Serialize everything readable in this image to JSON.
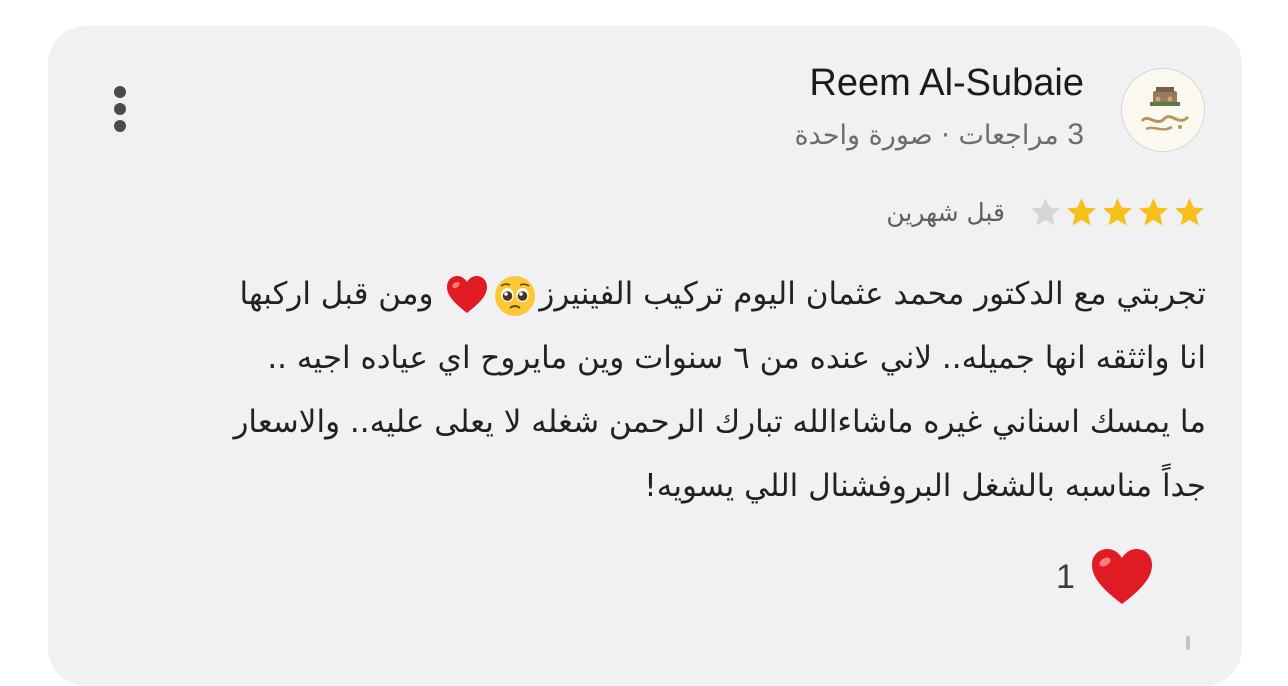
{
  "review": {
    "author_name": "Reem Al-Subaie",
    "reviews_count": "3",
    "reviews_label": "مراجعات",
    "separator": "·",
    "photos_label": "صورة واحدة",
    "rating": 4,
    "rating_max": 5,
    "date": "قبل شهرين",
    "text_line1_part1": "تجربتي مع الدكتور محمد عثمان اليوم تركيب الفينيرز",
    "text_line1_part2": " ومن قبل اركبها",
    "text_rest": "انا واثثقه انها جميله.. لاني عنده من ٦ سنوات وين مايروح اي عياده اجيه ..\nما يمسك اسناني غيره ماشاءالله تبارك الرحمن شغله لا يعلى عليه.. والاسعار\nجداً مناسبه بالشغل البروفشنال اللي يسويه!",
    "reaction_count": "1"
  },
  "icons": {
    "more": "more-vertical-icon",
    "star_filled": "star-filled-icon",
    "star_empty": "star-empty-icon",
    "pleading": "pleading-face-emoji",
    "heart": "red-heart-emoji"
  },
  "colors": {
    "star_filled": "#f6c01b",
    "star_empty": "#d5d5d8",
    "heart": "#e01b24",
    "card_bg": "#f1f1f3"
  }
}
